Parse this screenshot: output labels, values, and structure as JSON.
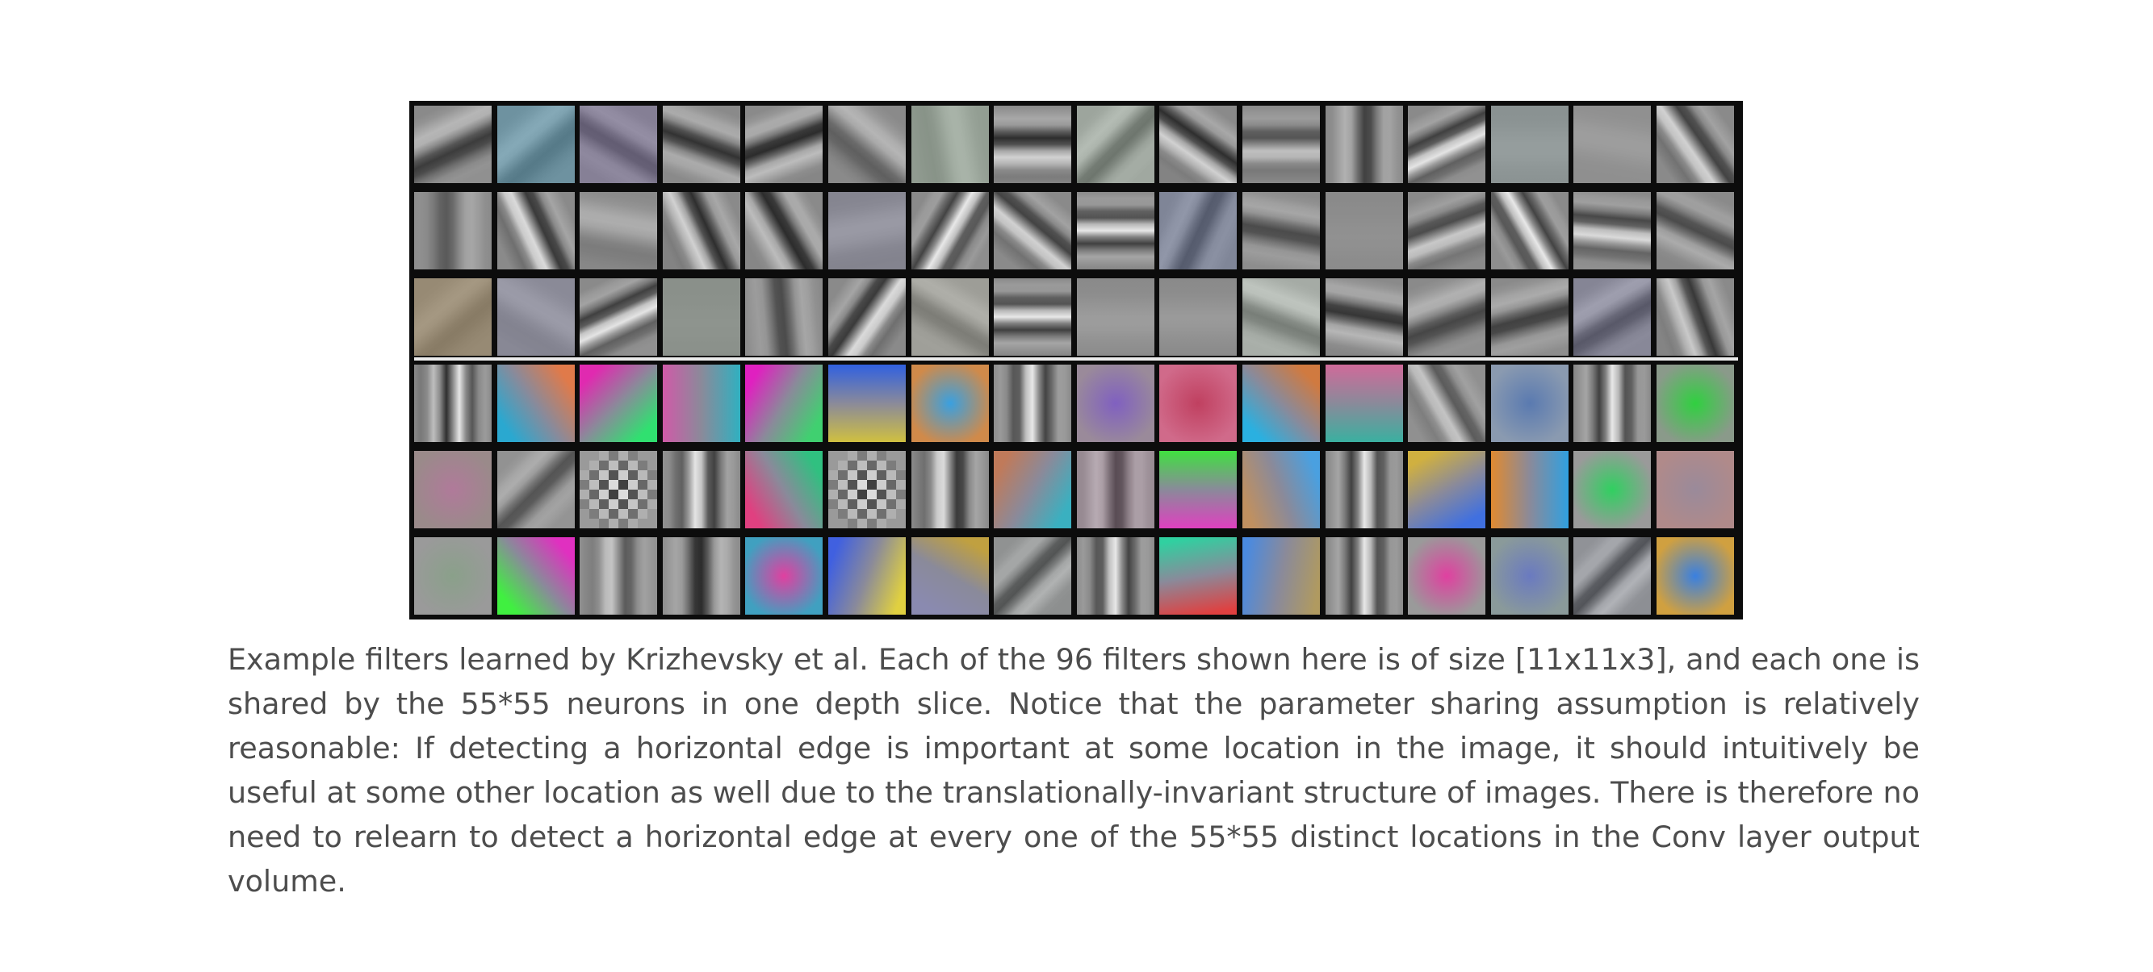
{
  "figure": {
    "rows": 6,
    "columns": 16,
    "filter_count": 96,
    "colors": {
      "frame": "#0c0c0c",
      "divider": "#ececec",
      "neutral_gray": "#8a8a8a"
    }
  },
  "caption": {
    "text": "Example filters learned by Krizhevsky et al. Each of the 96 filters shown here is of size [11x11x3], and each one is shared by the 55*55 neurons in one depth slice. Notice that the parameter sharing assumption is relatively reasonable: If detecting a horizontal edge is important at some location in the image, it should intuitively be useful at some other location as well due to the translationally-invariant structure of images. There is therefore no need to relearn to detect a horizontal edge at every one of the 55*55 distinct locations in the Conv layer output volume."
  }
}
